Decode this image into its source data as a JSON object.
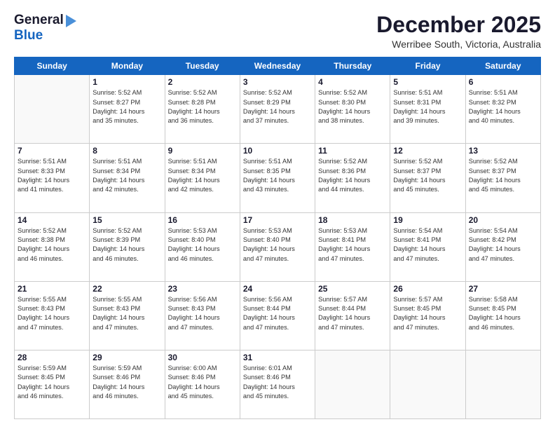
{
  "header": {
    "logo_general": "General",
    "logo_blue": "Blue",
    "title": "December 2025",
    "subtitle": "Werribee South, Victoria, Australia"
  },
  "weekdays": [
    "Sunday",
    "Monday",
    "Tuesday",
    "Wednesday",
    "Thursday",
    "Friday",
    "Saturday"
  ],
  "weeks": [
    [
      {
        "day": "",
        "lines": []
      },
      {
        "day": "1",
        "lines": [
          "Sunrise: 5:52 AM",
          "Sunset: 8:27 PM",
          "Daylight: 14 hours",
          "and 35 minutes."
        ]
      },
      {
        "day": "2",
        "lines": [
          "Sunrise: 5:52 AM",
          "Sunset: 8:28 PM",
          "Daylight: 14 hours",
          "and 36 minutes."
        ]
      },
      {
        "day": "3",
        "lines": [
          "Sunrise: 5:52 AM",
          "Sunset: 8:29 PM",
          "Daylight: 14 hours",
          "and 37 minutes."
        ]
      },
      {
        "day": "4",
        "lines": [
          "Sunrise: 5:52 AM",
          "Sunset: 8:30 PM",
          "Daylight: 14 hours",
          "and 38 minutes."
        ]
      },
      {
        "day": "5",
        "lines": [
          "Sunrise: 5:51 AM",
          "Sunset: 8:31 PM",
          "Daylight: 14 hours",
          "and 39 minutes."
        ]
      },
      {
        "day": "6",
        "lines": [
          "Sunrise: 5:51 AM",
          "Sunset: 8:32 PM",
          "Daylight: 14 hours",
          "and 40 minutes."
        ]
      }
    ],
    [
      {
        "day": "7",
        "lines": [
          "Sunrise: 5:51 AM",
          "Sunset: 8:33 PM",
          "Daylight: 14 hours",
          "and 41 minutes."
        ]
      },
      {
        "day": "8",
        "lines": [
          "Sunrise: 5:51 AM",
          "Sunset: 8:34 PM",
          "Daylight: 14 hours",
          "and 42 minutes."
        ]
      },
      {
        "day": "9",
        "lines": [
          "Sunrise: 5:51 AM",
          "Sunset: 8:34 PM",
          "Daylight: 14 hours",
          "and 42 minutes."
        ]
      },
      {
        "day": "10",
        "lines": [
          "Sunrise: 5:51 AM",
          "Sunset: 8:35 PM",
          "Daylight: 14 hours",
          "and 43 minutes."
        ]
      },
      {
        "day": "11",
        "lines": [
          "Sunrise: 5:52 AM",
          "Sunset: 8:36 PM",
          "Daylight: 14 hours",
          "and 44 minutes."
        ]
      },
      {
        "day": "12",
        "lines": [
          "Sunrise: 5:52 AM",
          "Sunset: 8:37 PM",
          "Daylight: 14 hours",
          "and 45 minutes."
        ]
      },
      {
        "day": "13",
        "lines": [
          "Sunrise: 5:52 AM",
          "Sunset: 8:37 PM",
          "Daylight: 14 hours",
          "and 45 minutes."
        ]
      }
    ],
    [
      {
        "day": "14",
        "lines": [
          "Sunrise: 5:52 AM",
          "Sunset: 8:38 PM",
          "Daylight: 14 hours",
          "and 46 minutes."
        ]
      },
      {
        "day": "15",
        "lines": [
          "Sunrise: 5:52 AM",
          "Sunset: 8:39 PM",
          "Daylight: 14 hours",
          "and 46 minutes."
        ]
      },
      {
        "day": "16",
        "lines": [
          "Sunrise: 5:53 AM",
          "Sunset: 8:40 PM",
          "Daylight: 14 hours",
          "and 46 minutes."
        ]
      },
      {
        "day": "17",
        "lines": [
          "Sunrise: 5:53 AM",
          "Sunset: 8:40 PM",
          "Daylight: 14 hours",
          "and 47 minutes."
        ]
      },
      {
        "day": "18",
        "lines": [
          "Sunrise: 5:53 AM",
          "Sunset: 8:41 PM",
          "Daylight: 14 hours",
          "and 47 minutes."
        ]
      },
      {
        "day": "19",
        "lines": [
          "Sunrise: 5:54 AM",
          "Sunset: 8:41 PM",
          "Daylight: 14 hours",
          "and 47 minutes."
        ]
      },
      {
        "day": "20",
        "lines": [
          "Sunrise: 5:54 AM",
          "Sunset: 8:42 PM",
          "Daylight: 14 hours",
          "and 47 minutes."
        ]
      }
    ],
    [
      {
        "day": "21",
        "lines": [
          "Sunrise: 5:55 AM",
          "Sunset: 8:43 PM",
          "Daylight: 14 hours",
          "and 47 minutes."
        ]
      },
      {
        "day": "22",
        "lines": [
          "Sunrise: 5:55 AM",
          "Sunset: 8:43 PM",
          "Daylight: 14 hours",
          "and 47 minutes."
        ]
      },
      {
        "day": "23",
        "lines": [
          "Sunrise: 5:56 AM",
          "Sunset: 8:43 PM",
          "Daylight: 14 hours",
          "and 47 minutes."
        ]
      },
      {
        "day": "24",
        "lines": [
          "Sunrise: 5:56 AM",
          "Sunset: 8:44 PM",
          "Daylight: 14 hours",
          "and 47 minutes."
        ]
      },
      {
        "day": "25",
        "lines": [
          "Sunrise: 5:57 AM",
          "Sunset: 8:44 PM",
          "Daylight: 14 hours",
          "and 47 minutes."
        ]
      },
      {
        "day": "26",
        "lines": [
          "Sunrise: 5:57 AM",
          "Sunset: 8:45 PM",
          "Daylight: 14 hours",
          "and 47 minutes."
        ]
      },
      {
        "day": "27",
        "lines": [
          "Sunrise: 5:58 AM",
          "Sunset: 8:45 PM",
          "Daylight: 14 hours",
          "and 46 minutes."
        ]
      }
    ],
    [
      {
        "day": "28",
        "lines": [
          "Sunrise: 5:59 AM",
          "Sunset: 8:45 PM",
          "Daylight: 14 hours",
          "and 46 minutes."
        ]
      },
      {
        "day": "29",
        "lines": [
          "Sunrise: 5:59 AM",
          "Sunset: 8:46 PM",
          "Daylight: 14 hours",
          "and 46 minutes."
        ]
      },
      {
        "day": "30",
        "lines": [
          "Sunrise: 6:00 AM",
          "Sunset: 8:46 PM",
          "Daylight: 14 hours",
          "and 45 minutes."
        ]
      },
      {
        "day": "31",
        "lines": [
          "Sunrise: 6:01 AM",
          "Sunset: 8:46 PM",
          "Daylight: 14 hours",
          "and 45 minutes."
        ]
      },
      {
        "day": "",
        "lines": []
      },
      {
        "day": "",
        "lines": []
      },
      {
        "day": "",
        "lines": []
      }
    ]
  ]
}
